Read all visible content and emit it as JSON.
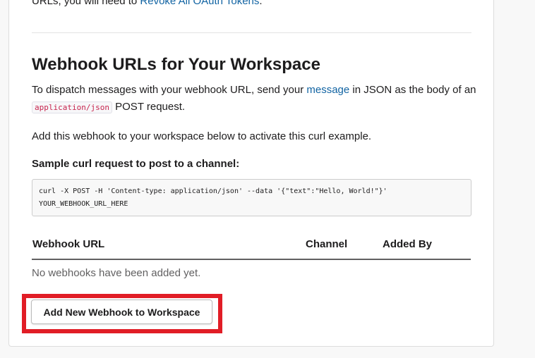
{
  "intro": {
    "text_before": "URLs, you will need to ",
    "link": "Revoke All OAuth Tokens",
    "text_after": "."
  },
  "section": {
    "title": "Webhook URLs for Your Workspace",
    "para1_before": "To dispatch messages with your webhook URL, send your ",
    "para1_link": "message",
    "para1_middle": " in JSON as the body of an ",
    "para1_code": "application/json",
    "para1_after": " POST request.",
    "para2": "Add this webhook to your workspace below to activate this curl example.",
    "sample_label": "Sample curl request to post to a channel:",
    "curl_line1": "curl -X POST -H 'Content-type: application/json' --data '{\"text\":\"Hello, World!\"}'",
    "curl_line2": "YOUR_WEBHOOK_URL_HERE"
  },
  "table": {
    "columns": [
      "Webhook URL",
      "Channel",
      "Added By"
    ],
    "empty_message": "No webhooks have been added yet."
  },
  "actions": {
    "add_button": "Add New Webhook to Workspace"
  },
  "colors": {
    "link": "#1264a3",
    "highlight": "#e11d26",
    "code": "#c7254e"
  }
}
